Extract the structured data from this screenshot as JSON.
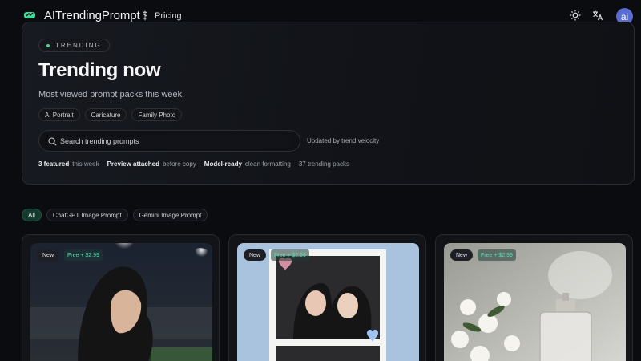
{
  "nav": {
    "brand": "AITrendingPrompt",
    "pricing_label": "Pricing",
    "avatar_initials": "ai"
  },
  "hero": {
    "badge": "TRENDING",
    "title": "Trending now",
    "subtitle": "Most viewed prompt packs this week.",
    "tags": [
      "AI Portrait",
      "Caricature",
      "Family Photo"
    ],
    "search_placeholder": "Search trending prompts",
    "search_note": "Updated by trend velocity",
    "stats": [
      {
        "strong": "3 featured",
        "text": "this week"
      },
      {
        "strong": "Preview attached",
        "text": "before copy"
      },
      {
        "strong": "Model-ready",
        "text": "clean formatting"
      },
      {
        "strong": "",
        "text": "37 trending packs"
      }
    ]
  },
  "filters": [
    "All",
    "ChatGPT Image Prompt",
    "Gemini Image Prompt"
  ],
  "cards": [
    {
      "badge": "New",
      "price": "Free + $2.99"
    },
    {
      "badge": "New",
      "price": "Free + $2.99"
    },
    {
      "badge": "New",
      "price": "Free + $2.99"
    }
  ],
  "colors": {
    "background": "#0b0c10",
    "accent_green": "#3ddc97",
    "price_text": "#52e0b0",
    "active_chip": "#163a2e",
    "avatar": "#5b6bd4"
  },
  "icons": [
    "logo-icon",
    "dollar-icon",
    "sun-icon",
    "translate-icon",
    "search-icon"
  ]
}
